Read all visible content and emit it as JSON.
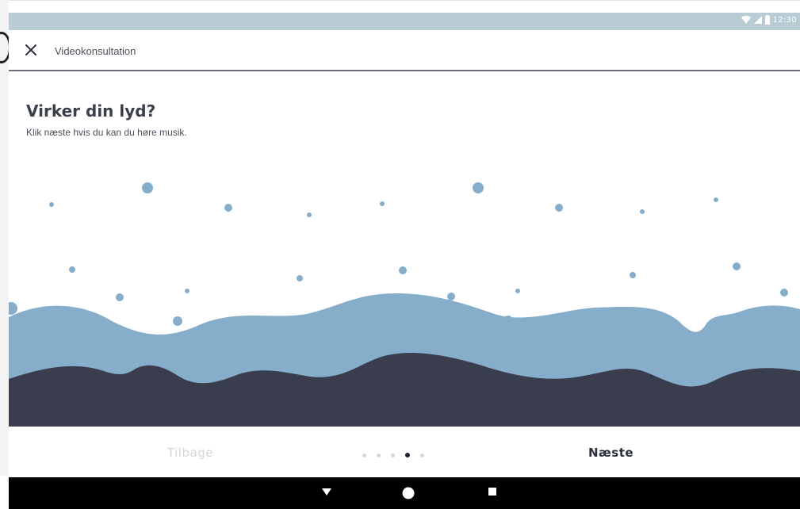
{
  "status_bar": {
    "time": "12:30",
    "background_color": "#b9cbd3"
  },
  "app_bar": {
    "title": "Videokonsultation",
    "close_icon": "close-icon"
  },
  "content": {
    "heading": "Virker din lyd?",
    "subheading": "Klik næste hvis du kan du høre musik.",
    "wave_light_color": "#86aecb",
    "wave_dark_color": "#3a3d4e",
    "bubble_color": "#86aecb"
  },
  "footer": {
    "back_label": "Tilbage",
    "next_label": "Næste",
    "page_count": 5,
    "current_page": 4
  },
  "nav_bar": {
    "back_icon": "triangle-down-icon",
    "home_icon": "circle-home-icon",
    "recent_icon": "square-recent-icon"
  }
}
